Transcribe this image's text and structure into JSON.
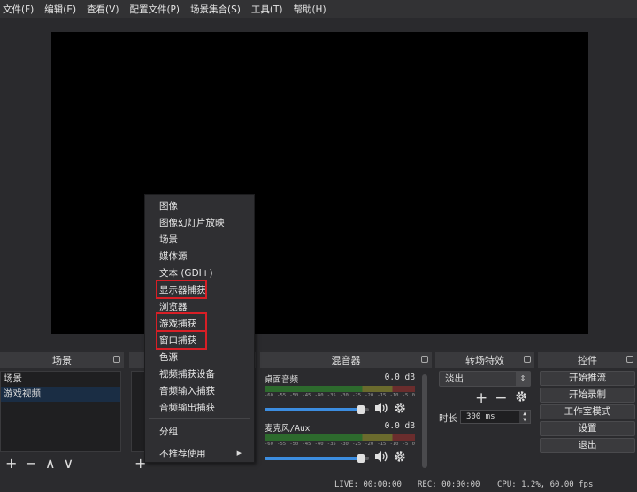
{
  "menubar": {
    "items": [
      "文件(F)",
      "编辑(E)",
      "查看(V)",
      "配置文件(P)",
      "场景集合(S)",
      "工具(T)",
      "帮助(H)"
    ]
  },
  "docks": {
    "scenes_title": "场景",
    "mixer_title": "混音器",
    "transitions_title": "转场特效",
    "controls_title": "控件"
  },
  "scenes": {
    "items": [
      "场景",
      "游戏视频"
    ],
    "selected_index": 1
  },
  "toolbar_glyphs": {
    "add": "+",
    "remove": "−",
    "up": "∧",
    "down": "∨"
  },
  "mixer": {
    "channels": [
      {
        "name": "桌面音频",
        "db": "0.0 dB",
        "volume": 0.92
      },
      {
        "name": "麦克风/Aux",
        "db": "0.0 dB",
        "volume": 0.92
      }
    ],
    "scale": [
      "-60",
      "-55",
      "-50",
      "-45",
      "-40",
      "-35",
      "-30",
      "-25",
      "-20",
      "-15",
      "-10",
      "-5",
      "0"
    ]
  },
  "transitions": {
    "selected": "淡出",
    "duration_label": "时长",
    "duration_value": "300 ms"
  },
  "controls": {
    "buttons": [
      "开始推流",
      "开始录制",
      "工作室模式",
      "设置",
      "退出"
    ]
  },
  "status": {
    "live": "LIVE: 00:00:00",
    "rec": "REC: 00:00:00",
    "cpu": "CPU: 1.2%, 60.00 fps"
  },
  "context_menu": {
    "items": [
      "图像",
      "图像幻灯片放映",
      "场景",
      "媒体源",
      "文本 (GDI+)",
      "显示器捕获",
      "浏览器",
      "游戏捕获",
      "窗口捕获",
      "色源",
      "视频捕获设备",
      "音频输入捕获",
      "音频输出捕获"
    ],
    "group": "分组",
    "deprecated": "不推荐使用",
    "highlighted": [
      "显示器捕获",
      "游戏捕获",
      "窗口捕获"
    ]
  },
  "colors": {
    "highlight": "#d81f26",
    "accent": "#3c8de0",
    "background": "#2b2b2e"
  }
}
